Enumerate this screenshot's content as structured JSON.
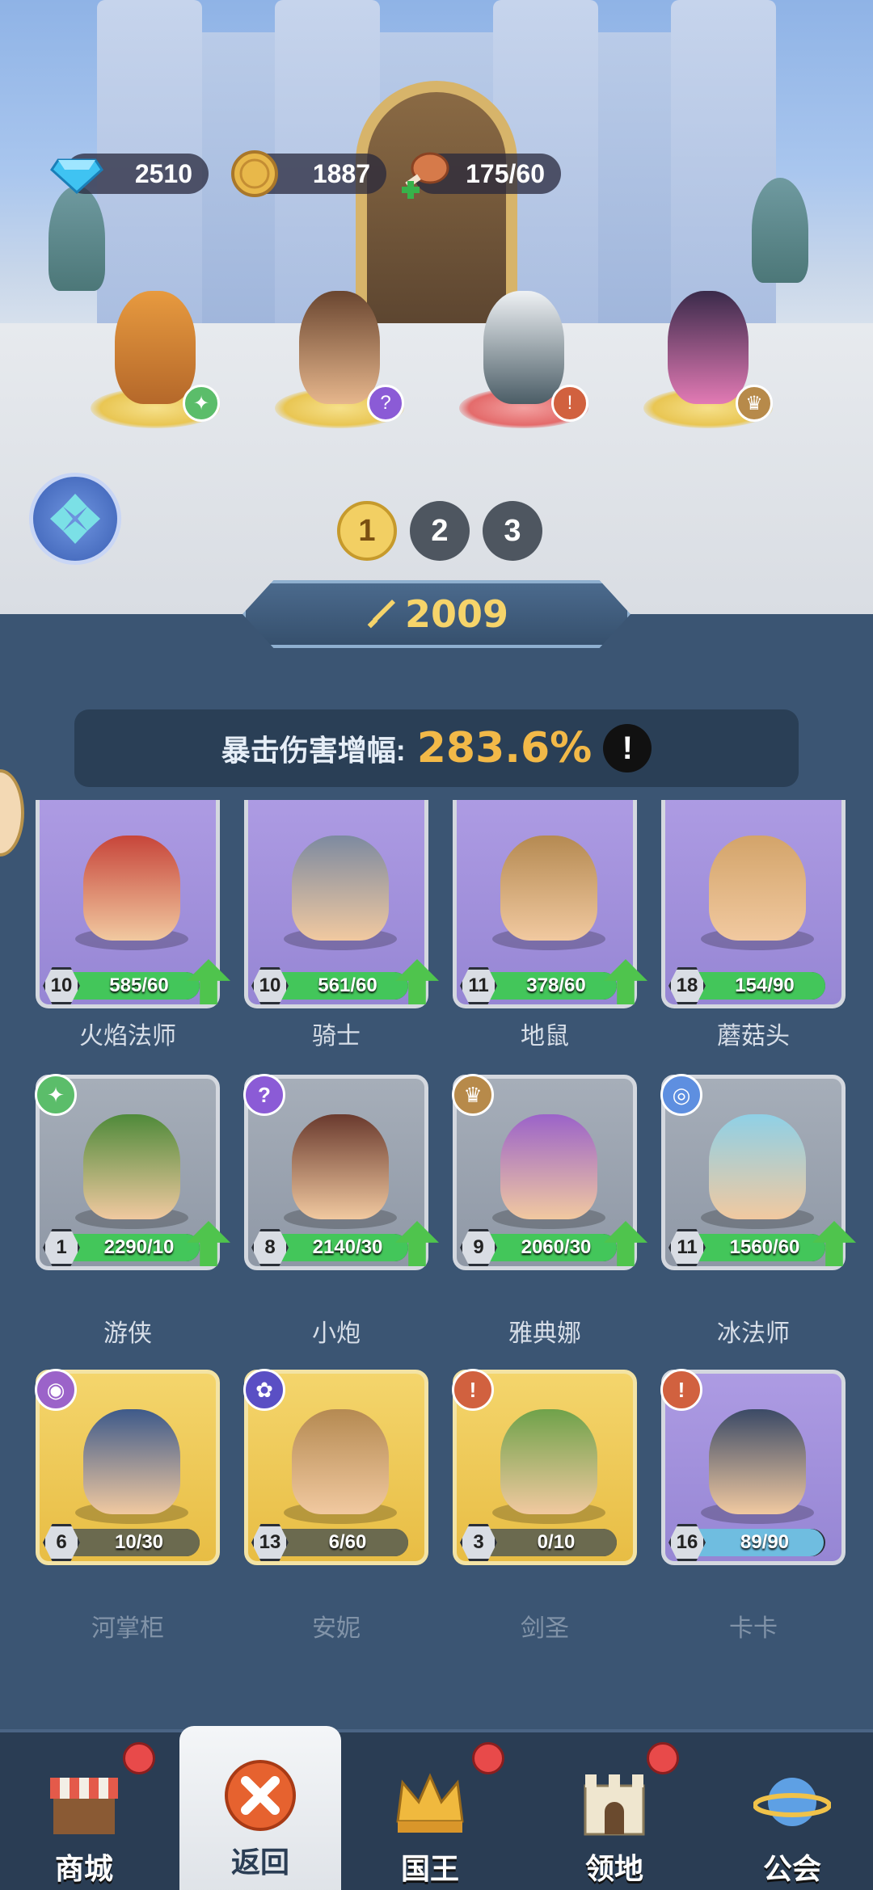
{
  "resources": {
    "gems": "2510",
    "coins": "1887",
    "stamina": "175/60"
  },
  "team": [
    {
      "name": "raccoon-gunner",
      "element_icon": "constellation-icon",
      "badge_color": "#5bbd6a"
    },
    {
      "name": "laurel-warrior",
      "element_icon": "question-icon",
      "badge_color": "#8b5bd6"
    },
    {
      "name": "white-hair-spearman",
      "element_icon": "sword-icon",
      "badge_color": "#d1613f"
    },
    {
      "name": "pink-horned-singer",
      "element_icon": "crown-wing-icon",
      "badge_color": "#b78a4a"
    }
  ],
  "pages": [
    "1",
    "2",
    "3"
  ],
  "active_page": "1",
  "power": "2009",
  "stat": {
    "label": "暴击伤害增幅:",
    "value": "283.6%",
    "info": "!"
  },
  "heroes": [
    {
      "name": "火焰法师",
      "level": "10",
      "progress": "585/60",
      "fraction": 1.0,
      "rarity": "purple",
      "upgrade": true
    },
    {
      "name": "骑士",
      "level": "10",
      "progress": "561/60",
      "fraction": 1.0,
      "rarity": "purple",
      "upgrade": true
    },
    {
      "name": "地鼠",
      "level": "11",
      "progress": "378/60",
      "fraction": 1.0,
      "rarity": "purple",
      "upgrade": true
    },
    {
      "name": "蘑菇头",
      "level": "18",
      "progress": "154/90",
      "fraction": 1.0,
      "rarity": "purple",
      "upgrade": false
    },
    {
      "name": "游侠",
      "level": "1",
      "progress": "2290/10",
      "fraction": 1.0,
      "rarity": "gray",
      "upgrade": true,
      "element_icon": "constellation-icon"
    },
    {
      "name": "小炮",
      "level": "8",
      "progress": "2140/30",
      "fraction": 1.0,
      "rarity": "gray",
      "upgrade": true,
      "element_icon": "question-icon"
    },
    {
      "name": "雅典娜",
      "level": "9",
      "progress": "2060/30",
      "fraction": 1.0,
      "rarity": "gray",
      "upgrade": true,
      "element_icon": "crown-wing-icon"
    },
    {
      "name": "冰法师",
      "level": "11",
      "progress": "1560/60",
      "fraction": 1.0,
      "rarity": "gray",
      "upgrade": true,
      "element_icon": "spiral-icon"
    },
    {
      "name": "河掌柜",
      "level": "6",
      "progress": "10/30",
      "fraction": 0.33,
      "rarity": "gold",
      "upgrade": false,
      "element_icon": "eye-icon"
    },
    {
      "name": "安妮",
      "level": "13",
      "progress": "6/60",
      "fraction": 0.1,
      "rarity": "gold",
      "upgrade": false,
      "element_icon": "paw-icon"
    },
    {
      "name": "剑圣",
      "level": "3",
      "progress": "0/10",
      "fraction": 0.0,
      "rarity": "gold",
      "upgrade": false,
      "element_icon": "sword-icon"
    },
    {
      "name": "卡卡",
      "level": "16",
      "progress": "89/90",
      "fraction": 0.99,
      "rarity": "purple",
      "upgrade": false,
      "element_icon": "sword-icon"
    }
  ],
  "nav": [
    {
      "label": "商城",
      "icon": "shop-icon",
      "notify": true
    },
    {
      "label": "返回",
      "icon": "close-icon",
      "notify": false,
      "active": true
    },
    {
      "label": "国王",
      "icon": "crown-icon",
      "notify": true
    },
    {
      "label": "领地",
      "icon": "castle-icon",
      "notify": true
    },
    {
      "label": "公会",
      "icon": "planet-icon",
      "notify": false
    }
  ],
  "colors": {
    "gold_text": "#f6d46a",
    "stat_value": "#f2b948",
    "upgrade_green": "#4fc44d",
    "panel_bg": "#3b5573"
  }
}
